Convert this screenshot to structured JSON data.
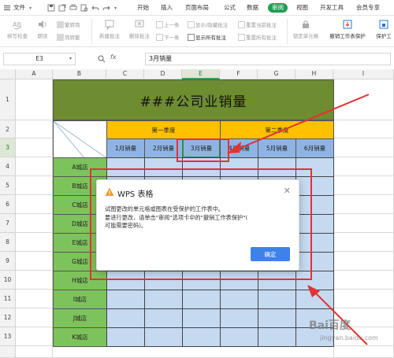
{
  "menubar": {
    "file_label": "文件",
    "tabs": [
      "开始",
      "插入",
      "页面布局",
      "公式",
      "数据",
      "审阅",
      "视图",
      "开发工具",
      "会员专享"
    ]
  },
  "ribbon": {
    "spell_check": "拼写检查",
    "read_aloud": "朗读",
    "trad_to_simp": "繁转简",
    "simp_to_trad": "简转繁",
    "new_comment": "新建批注",
    "delete_comment": "删除批注",
    "prev_item": "上一条",
    "next_item": "下一条",
    "show_hide_comment": "显示/隐藏批注",
    "show_all_comments": "显示所有批注",
    "reset_current_comment": "重置当前批注",
    "reset_all_comments": "重置所有批注",
    "lock_cell": "锁定单元格",
    "unprotect_sheet": "撤销工作表保护",
    "protect_workbook": "保护工"
  },
  "formula_bar": {
    "cell_ref": "E3",
    "fx": "fx",
    "value": "3月销量"
  },
  "grid": {
    "columns": [
      "A",
      "B",
      "C",
      "D",
      "E",
      "F",
      "G",
      "H",
      "I"
    ],
    "rows": [
      "1",
      "2",
      "3",
      "4",
      "5",
      "6",
      "7",
      "8",
      "9",
      "10",
      "11",
      "12",
      "13"
    ],
    "selected_column": "E",
    "selected_row": "3"
  },
  "sheet": {
    "title": "###公司业销量",
    "quarter_1": "第一季度",
    "quarter_2": "第二季度",
    "months": [
      "1月销量",
      "2月销量",
      "3月销量",
      "4月销量",
      "5月销量",
      "6月销量"
    ],
    "stores": [
      "A城店",
      "B城店",
      "C城店",
      "D城店",
      "E城店",
      "G城店",
      "H城店",
      "I城店",
      "J城店",
      "K城店"
    ]
  },
  "dialog": {
    "title": "WPS 表格",
    "message_line1": "试图更改的单元格或图表在受保护的工作表中。",
    "message_line2": "要进行更改，请单击\"审阅\"选项卡中的\"撤销工作表保护\"(",
    "message_line3": "可能需要密码)。",
    "ok_label": "确定"
  },
  "watermark": {
    "text": "Bai百度",
    "sub": "jingyan.baidu.com"
  },
  "colors": {
    "review_tab": "#1f9d55",
    "title_fill": "#6e8c30",
    "quarter_fill": "#ffc000",
    "month_fill": "#8fb4e3",
    "store_fill": "#7dc35b",
    "data_fill": "#c5d9f1",
    "ok_button": "#3d82e8",
    "annotation_red": "#e53232"
  }
}
